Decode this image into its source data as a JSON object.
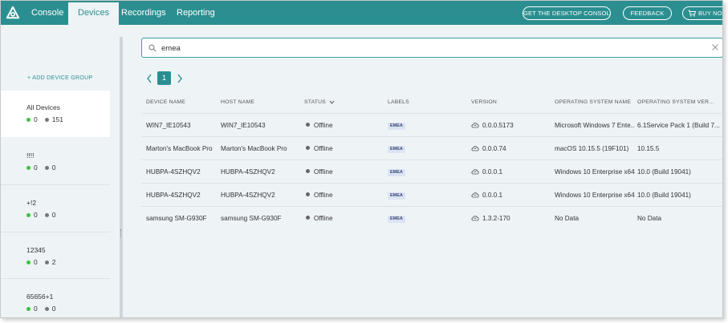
{
  "nav": {
    "tabs": [
      {
        "label": "Console"
      },
      {
        "label": "Devices"
      },
      {
        "label": "Recordings"
      },
      {
        "label": "Reporting"
      }
    ],
    "active_tab": "Devices",
    "buttons": {
      "desktop_console": "GET THE DESKTOP CONSOLE",
      "feedback": "FEEDBACK",
      "buy_now": "BUY NO"
    }
  },
  "sidebar": {
    "add_group": "+ ADD DEVICE GROUP",
    "groups": [
      {
        "name": "All Devices",
        "online": "0",
        "offline": "151"
      },
      {
        "name": "!!!!",
        "online": "0",
        "offline": "0"
      },
      {
        "name": "+!2",
        "online": "0",
        "offline": "0"
      },
      {
        "name": "12345",
        "online": "0",
        "offline": "2"
      },
      {
        "name": "65656+1",
        "online": "0",
        "offline": "0"
      }
    ]
  },
  "search": {
    "value": "emea",
    "placeholder": "Search"
  },
  "pager": {
    "current": "1"
  },
  "table": {
    "headers": {
      "device_name": "DEVICE NAME",
      "host_name": "HOST NAME",
      "status": "STATUS",
      "labels": "LABELS",
      "version": "VERSION",
      "os_name": "OPERATING SYSTEM NAME",
      "os_version": "OPERATING SYSTEM VER..."
    },
    "rows": [
      {
        "device": "WIN7_IE10543",
        "host": "WIN7_IE10543",
        "status": "Offline",
        "label": "EMEA",
        "version": "0.0.0.5173",
        "os": "Microsoft Windows 7 Ente...",
        "osver": "6.1Service Pack 1 (Build 7..."
      },
      {
        "device": "Marton's MacBook Pro",
        "host": "Marton's MacBook Pro",
        "status": "Offline",
        "label": "EMEA",
        "version": "0.0.0.74",
        "os": "macOS 10.15.5 (19F101)",
        "osver": "10.15.5"
      },
      {
        "device": "HUBPA-4SZHQV2",
        "host": "HUBPA-4SZHQV2",
        "status": "Offline",
        "label": "EMEA",
        "version": "0.0.0.1",
        "os": "Windows 10 Enterprise x64",
        "osver": "10.0 (Build 19041)"
      },
      {
        "device": "HUBPA-4SZHQV2",
        "host": "HUBPA-4SZHQV2",
        "status": "Offline",
        "label": "EMEA",
        "version": "0.0.0.1",
        "os": "Windows 10 Enterprise x64",
        "osver": "10.0 (Build 19041)"
      },
      {
        "device": "samsung SM-G930F",
        "host": "samsung SM-G930F",
        "status": "Offline",
        "label": "EMEA",
        "version": "1.3.2-170",
        "os": "No Data",
        "osver": "No Data"
      }
    ]
  },
  "colors": {
    "brand": "#2b8f91",
    "online": "#3ec13e",
    "offline": "#777777",
    "label_bg": "#dbe4f3"
  },
  "icons": [
    "logo-icon",
    "search-icon",
    "clear-icon",
    "chevron-left-icon",
    "chevron-right-icon",
    "sort-down-icon",
    "cloud-icon",
    "cart-icon"
  ]
}
